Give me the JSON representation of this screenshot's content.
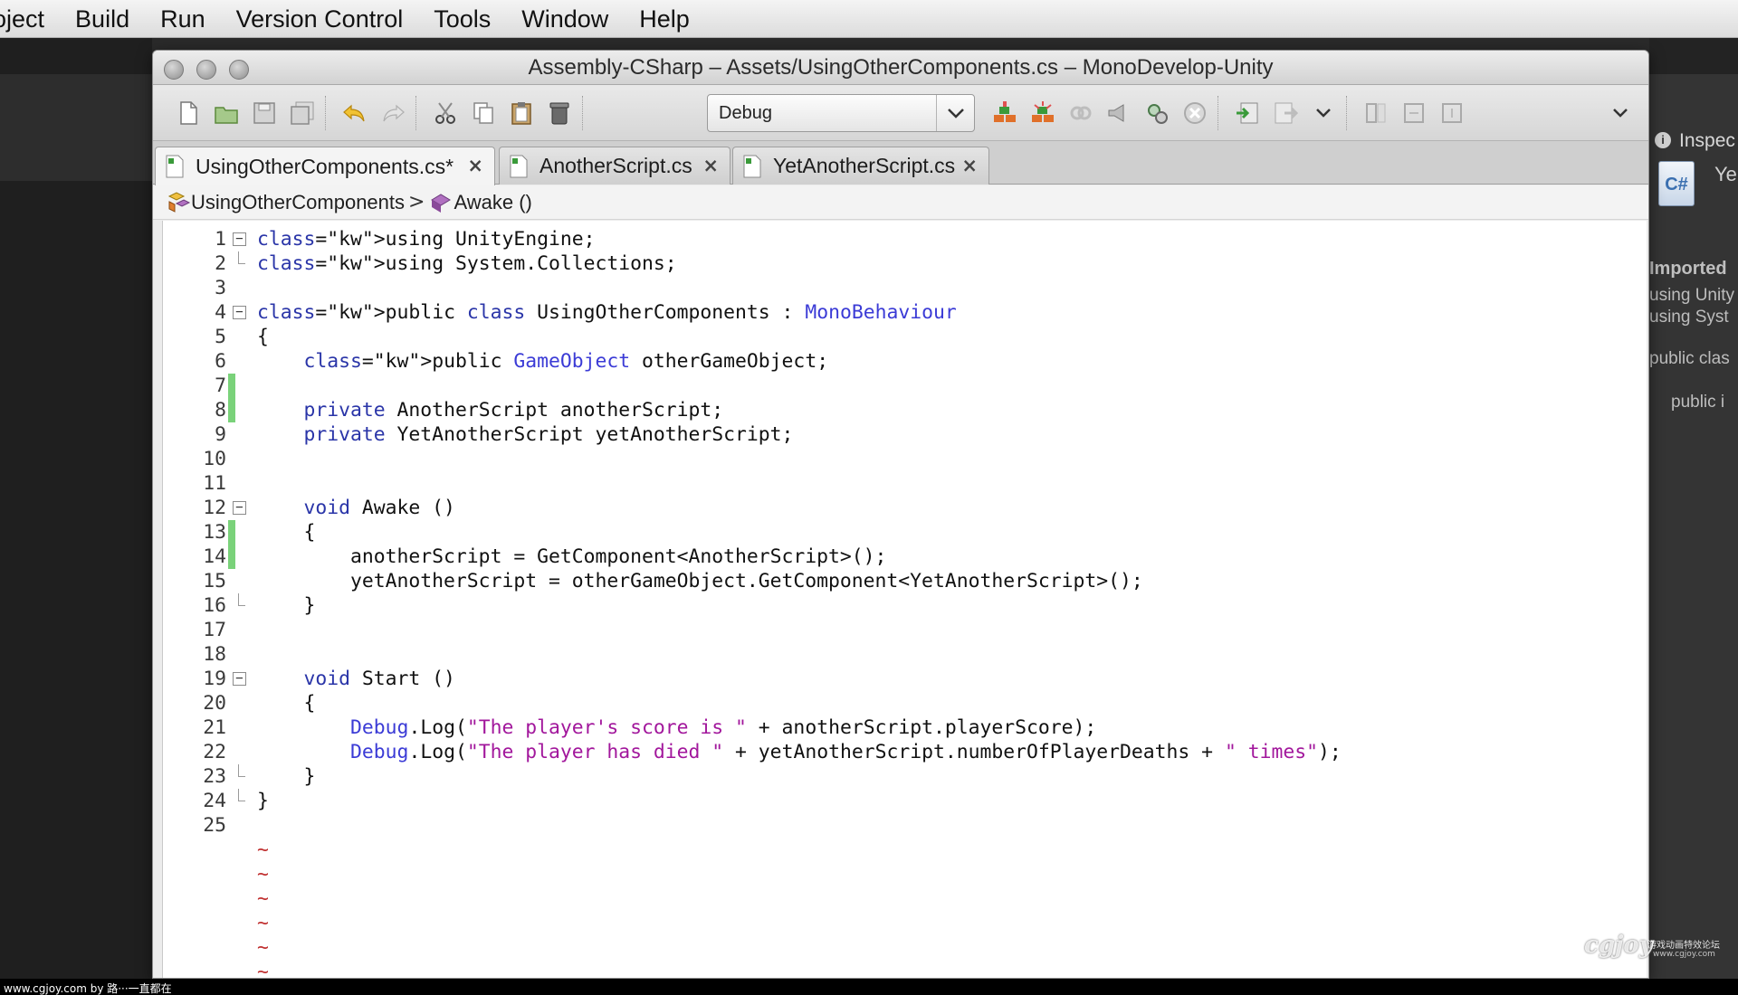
{
  "menubar": {
    "items": [
      "oject",
      "Build",
      "Run",
      "Version Control",
      "Tools",
      "Window",
      "Help"
    ]
  },
  "window": {
    "title": "Assembly-CSharp – Assets/UsingOtherComponents.cs – MonoDevelop-Unity"
  },
  "toolbar": {
    "configuration": "Debug"
  },
  "tabs": [
    {
      "label": "UsingOtherComponents.cs*",
      "close": "×",
      "active": true
    },
    {
      "label": "AnotherScript.cs",
      "close": "×",
      "active": false
    },
    {
      "label": "YetAnotherScript.cs",
      "close": "×",
      "active": false
    }
  ],
  "breadcrumb": {
    "class_name": "UsingOtherComponents",
    "separator": ">",
    "method": "Awake ()"
  },
  "editor": {
    "line_numbers": [
      "1",
      "2",
      "3",
      "4",
      "5",
      "6",
      "7",
      "8",
      "9",
      "10",
      "11",
      "12",
      "13",
      "14",
      "15",
      "16",
      "17",
      "18",
      "19",
      "20",
      "21",
      "22",
      "23",
      "24",
      "25"
    ],
    "code": [
      "using UnityEngine;",
      "using System.Collections;",
      "",
      "public class UsingOtherComponents : MonoBehaviour",
      "{",
      "    public GameObject otherGameObject;",
      "",
      "    private AnotherScript anotherScript;",
      "    private YetAnotherScript yetAnotherScript;",
      "",
      "",
      "    void Awake ()",
      "    {",
      "        anotherScript = GetComponent<AnotherScript>();",
      "        yetAnotherScript = otherGameObject.GetComponent<YetAnotherScript>();",
      "    }",
      "",
      "",
      "    void Start ()",
      "    {",
      "        Debug.Log(\"The player's score is \" + anotherScript.playerScore);",
      "        Debug.Log(\"The player has died \" + yetAnotherScript.numberOfPlayerDeaths + \" times\");",
      "    }",
      "}",
      ""
    ],
    "fold_open_lines": [
      1,
      4,
      12,
      19
    ],
    "fold_end_lines": [
      2,
      16,
      23,
      24
    ],
    "modified_lines": [
      7,
      8,
      13,
      14
    ],
    "tilde": "~"
  },
  "inspector_peek": {
    "header": "Inspec",
    "item": "Ye",
    "imported": "Imported",
    "preview_lines": [
      "using Unity",
      "using Syst",
      "public clas",
      "public i"
    ]
  },
  "footer": {
    "text": "www.cgjoy.com by 路···一直都在"
  },
  "watermark": {
    "logo": "cgjoy",
    "subtitle": "游戏动画特效论坛",
    "url": "www.cgjoy.com"
  },
  "colors": {
    "keyword": "#2a35a8",
    "type": "#3b3bd6",
    "string": "#a2179c",
    "modified_marker": "#7ad27a"
  }
}
